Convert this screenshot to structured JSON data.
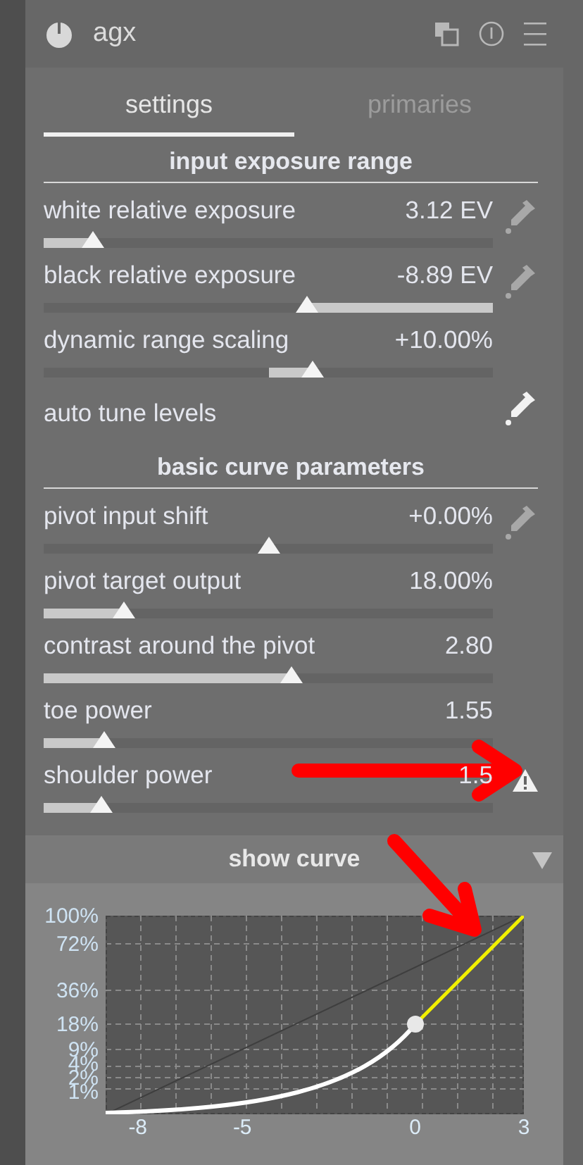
{
  "module": {
    "title": "agx",
    "enabled": true
  },
  "tabs": [
    {
      "label": "settings",
      "selected": true
    },
    {
      "label": "primaries",
      "selected": false
    }
  ],
  "rows": [
    {
      "kind": "section",
      "label": "input exposure range"
    },
    {
      "kind": "slider",
      "label": "white relative exposure",
      "value": "3.12 EV",
      "level": 0.11,
      "picker": true
    },
    {
      "kind": "inverted_slider",
      "label": "black relative exposure",
      "value": "-8.89 EV",
      "level": 0.586,
      "picker": true
    },
    {
      "kind": "centered_slider",
      "label": "dynamic range scaling",
      "value": "+10.00%",
      "level": 0.6
    },
    {
      "kind": "button",
      "label": "auto tune levels",
      "picker": true
    },
    {
      "kind": "section",
      "label": "basic curve parameters"
    },
    {
      "kind": "centered_slider",
      "label": "pivot input shift",
      "value": "+0.00%",
      "level": 0.5,
      "picker": true
    },
    {
      "kind": "slider",
      "label": "pivot target output",
      "value": "18.00%",
      "level": 0.18
    },
    {
      "kind": "slider",
      "label": "contrast around the pivot",
      "value": "2.80",
      "level": 0.553
    },
    {
      "kind": "slider",
      "label": "toe power",
      "value": "1.55",
      "level": 0.136
    },
    {
      "kind": "slider",
      "label": "shoulder power",
      "value": "1.5",
      "level": 0.127,
      "warning": true
    }
  ],
  "curve": {
    "title": "show curve",
    "expanded": true,
    "y_labels": [
      "100%",
      "72%",
      "36%",
      "18%",
      "9%",
      "4%",
      "2%",
      "1%"
    ],
    "x_labels": [
      "-8",
      "-5",
      "0",
      "3"
    ]
  }
}
